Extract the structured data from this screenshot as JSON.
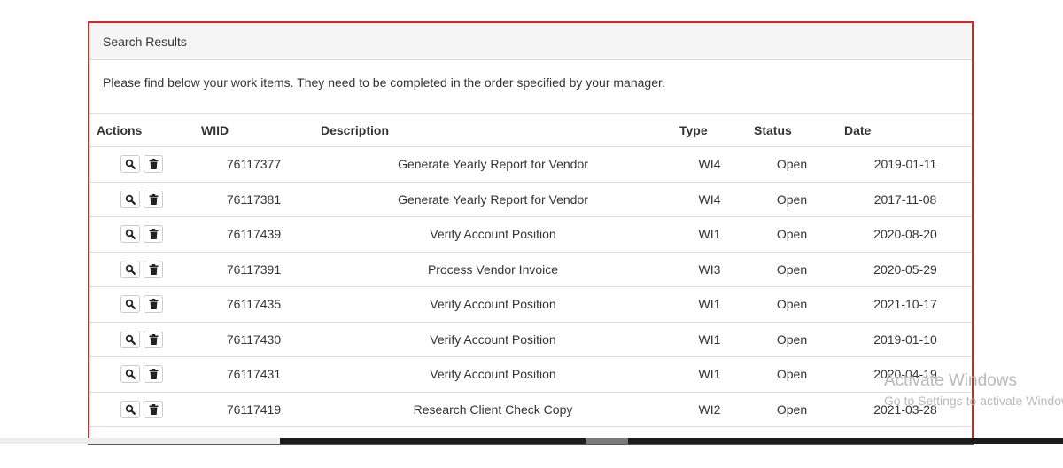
{
  "panel": {
    "title": "Search Results",
    "instructions": "Please find below your work items. They need to be completed in the order specified by your manager."
  },
  "table": {
    "headers": {
      "actions": "Actions",
      "wiid": "WIID",
      "description": "Description",
      "type": "Type",
      "status": "Status",
      "date": "Date"
    },
    "rows": [
      {
        "wiid": "76117377",
        "description": "Generate Yearly Report for Vendor",
        "type": "WI4",
        "status": "Open",
        "date": "2019-01-11"
      },
      {
        "wiid": "76117381",
        "description": "Generate Yearly Report for Vendor",
        "type": "WI4",
        "status": "Open",
        "date": "2017-11-08"
      },
      {
        "wiid": "76117439",
        "description": "Verify Account Position",
        "type": "WI1",
        "status": "Open",
        "date": "2020-08-20"
      },
      {
        "wiid": "76117391",
        "description": "Process Vendor Invoice",
        "type": "WI3",
        "status": "Open",
        "date": "2020-05-29"
      },
      {
        "wiid": "76117435",
        "description": "Verify Account Position",
        "type": "WI1",
        "status": "Open",
        "date": "2021-10-17"
      },
      {
        "wiid": "76117430",
        "description": "Verify Account Position",
        "type": "WI1",
        "status": "Open",
        "date": "2019-01-10"
      },
      {
        "wiid": "76117431",
        "description": "Verify Account Position",
        "type": "WI1",
        "status": "Open",
        "date": "2020-04-19"
      },
      {
        "wiid": "76117419",
        "description": "Research Client Check Copy",
        "type": "WI2",
        "status": "Open",
        "date": "2021-03-28"
      }
    ]
  },
  "watermark": {
    "line1": "Activate Windows",
    "line2": "Go to Settings to activate Windows."
  },
  "colors": {
    "panel_border": "#d9261c",
    "heading_bg": "#f5f5f5"
  },
  "icons": {
    "view": "search-icon",
    "delete": "trash-icon"
  }
}
